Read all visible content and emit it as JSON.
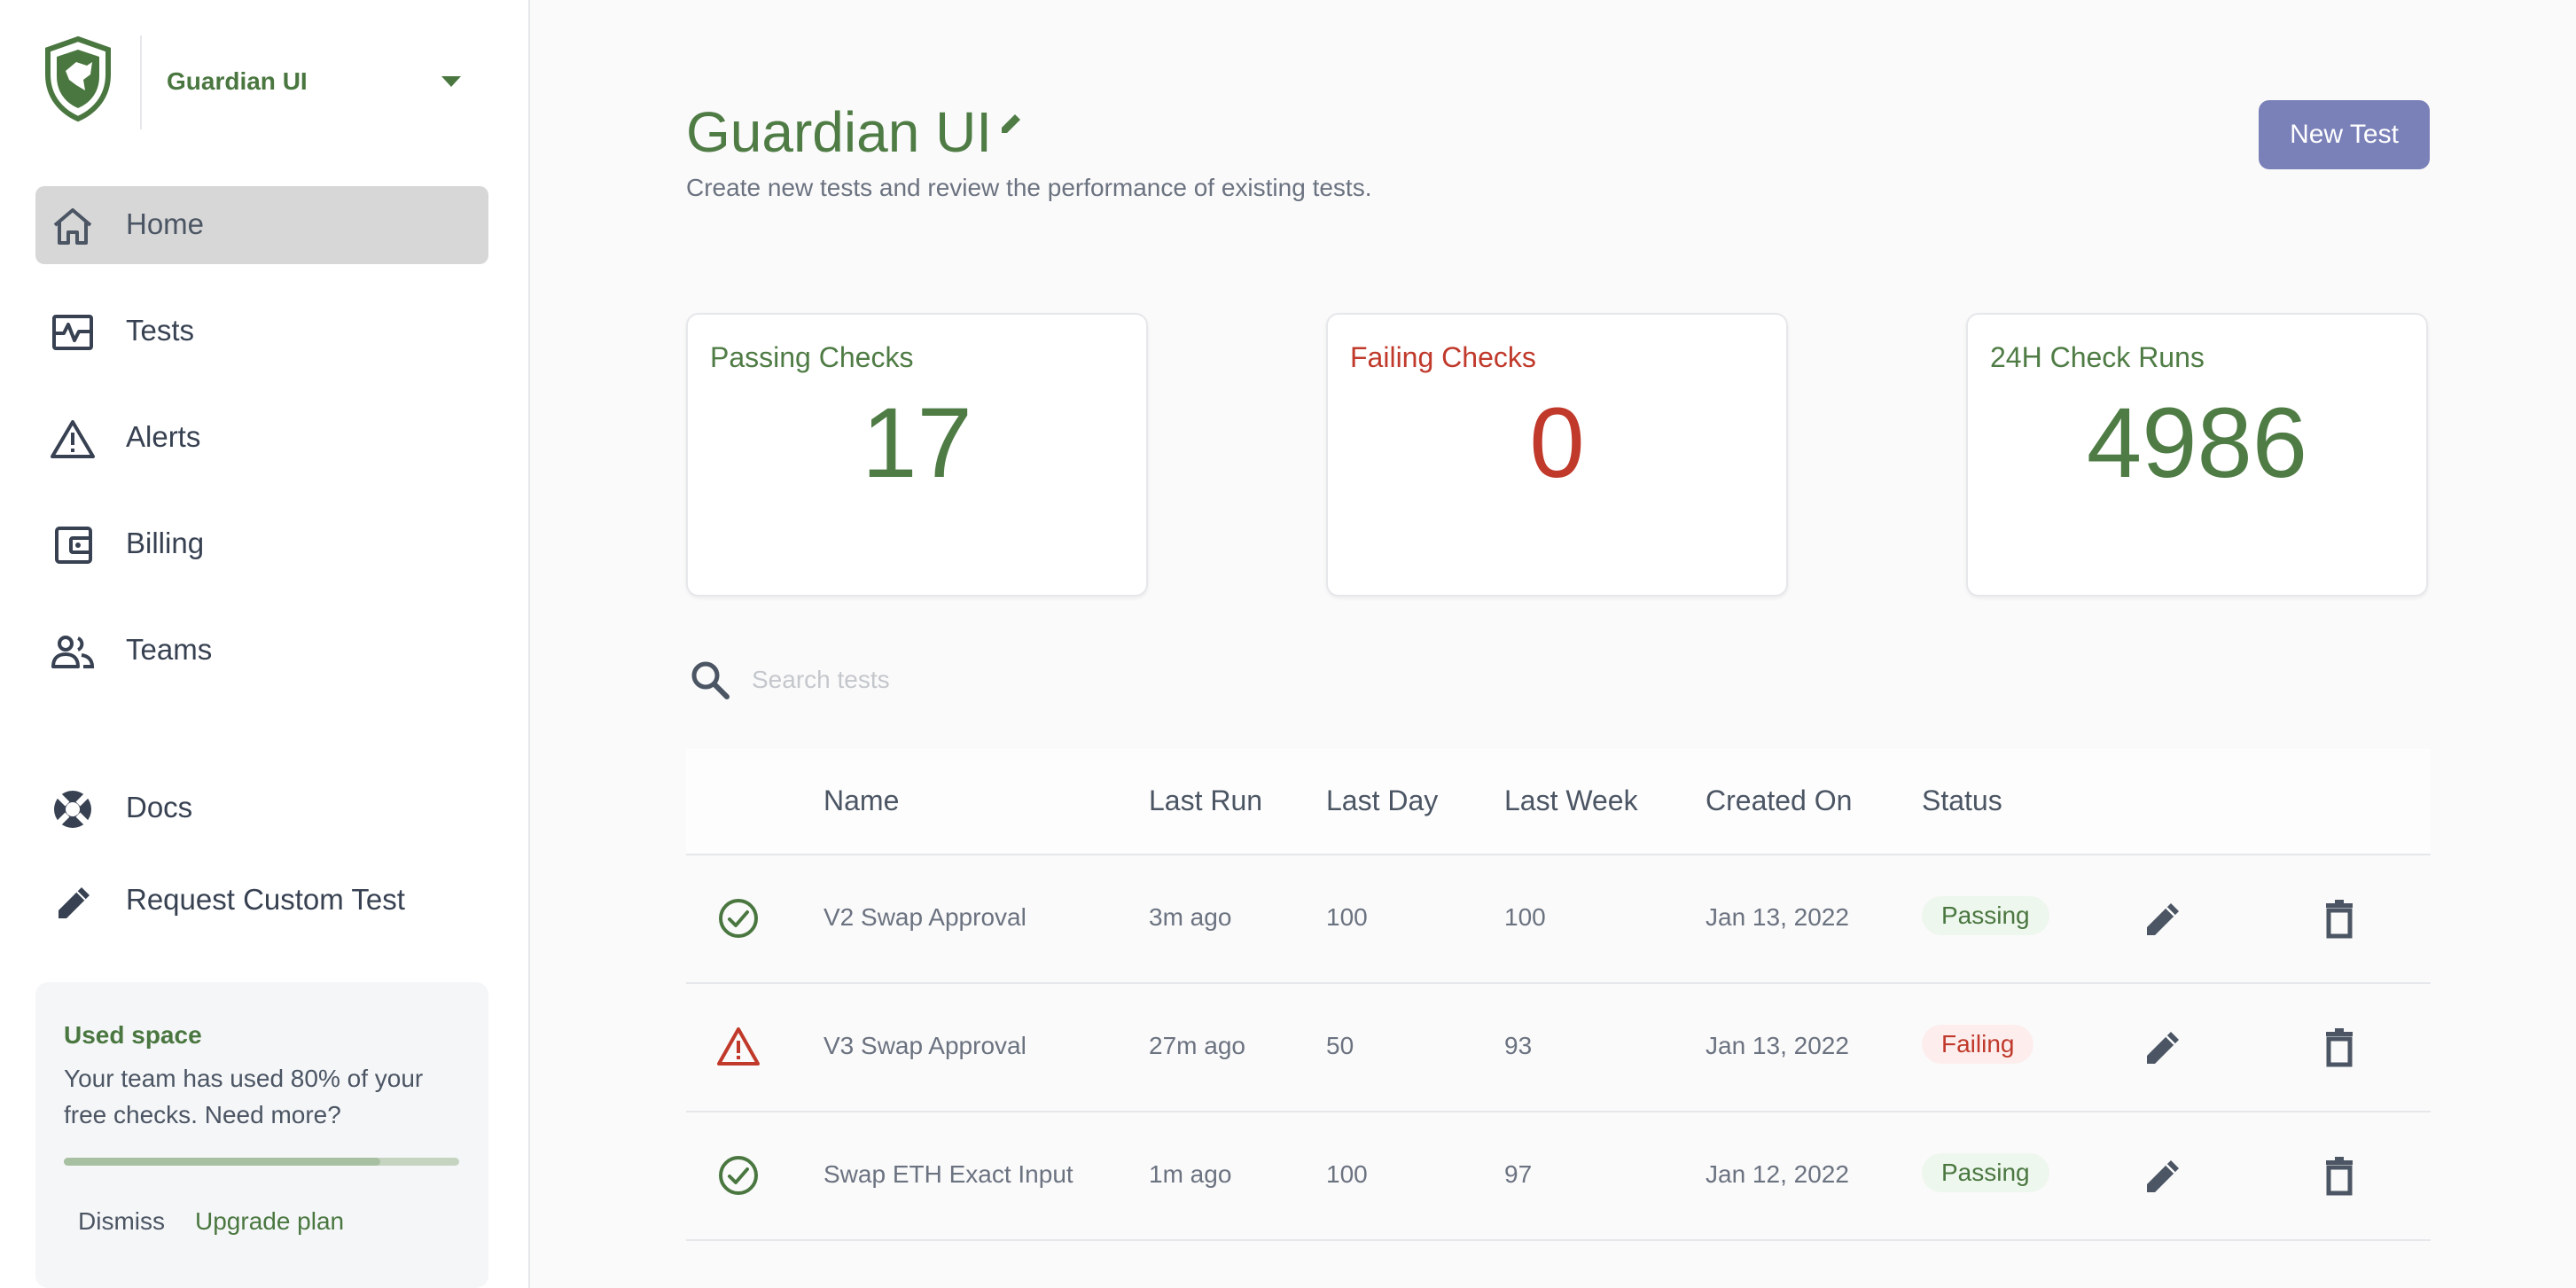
{
  "app": {
    "name": "Guardian UI"
  },
  "nav": {
    "items": [
      {
        "label": "Home",
        "icon": "home-icon"
      },
      {
        "label": "Tests",
        "icon": "pulse-icon"
      },
      {
        "label": "Alerts",
        "icon": "warning-icon"
      },
      {
        "label": "Billing",
        "icon": "wallet-icon"
      },
      {
        "label": "Teams",
        "icon": "people-icon"
      }
    ],
    "secondary": [
      {
        "label": "Docs",
        "icon": "lifebuoy-icon"
      },
      {
        "label": "Request Custom Test",
        "icon": "pencil-icon"
      }
    ]
  },
  "usage": {
    "title": "Used space",
    "description": "Your team has used 80% of your free checks. Need more?",
    "progress": 0.8,
    "dismiss": "Dismiss",
    "upgrade": "Upgrade plan"
  },
  "header": {
    "title": "Guardian UI",
    "subtitle": "Create new tests and review the performance of existing tests.",
    "new_test": "New Test"
  },
  "stats": [
    {
      "label": "Passing Checks",
      "value": "17",
      "color": "#4f7c45"
    },
    {
      "label": "Failing Checks",
      "value": "0",
      "color": "#c0392b"
    },
    {
      "label": "24H Check Runs",
      "value": "4986",
      "color": "#4f7c45"
    }
  ],
  "search": {
    "placeholder": "Search tests"
  },
  "table": {
    "columns": [
      "Name",
      "Last Run",
      "Last Day",
      "Last Week",
      "Created On",
      "Status"
    ],
    "rows": [
      {
        "name": "V2 Swap Approval",
        "last_run": "3m ago",
        "last_day": "100",
        "last_week": "100",
        "created_on": "Jan 13, 2022",
        "status": "Passing"
      },
      {
        "name": "V3 Swap Approval",
        "last_run": "27m ago",
        "last_day": "50",
        "last_week": "93",
        "created_on": "Jan 13, 2022",
        "status": "Failing"
      },
      {
        "name": "Swap ETH Exact Input",
        "last_run": "1m ago",
        "last_day": "100",
        "last_week": "97",
        "created_on": "Jan 12, 2022",
        "status": "Passing"
      }
    ]
  },
  "colors": {
    "brand_green": "#4f7c45",
    "fail_red": "#c0392b",
    "accent_button": "#7a80b8",
    "active_nav": "#d7d7d7"
  }
}
